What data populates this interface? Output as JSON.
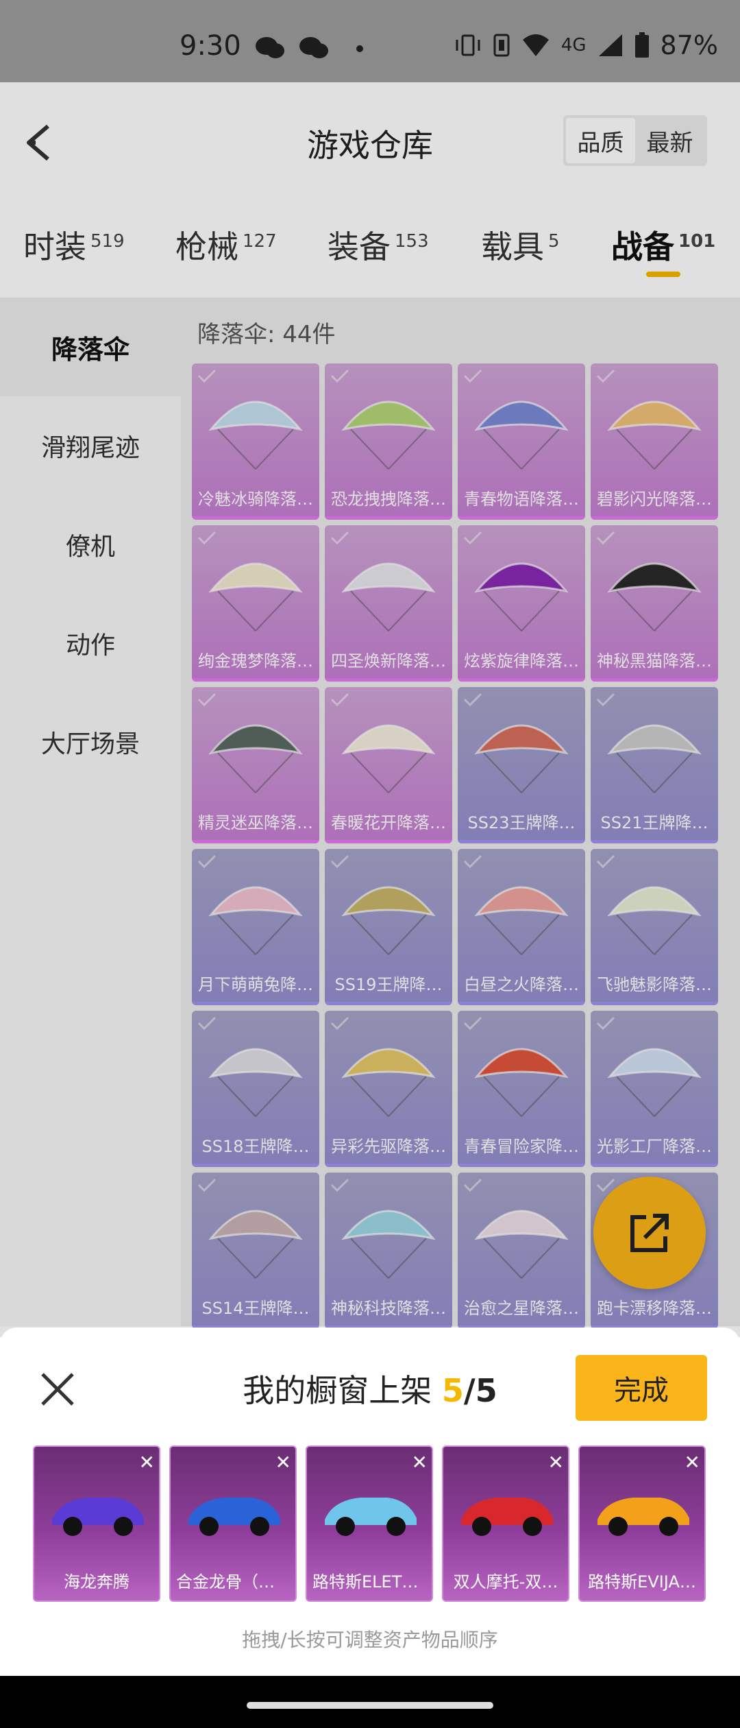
{
  "status_bar": {
    "time": "9:30",
    "network": "4G",
    "battery": "87%"
  },
  "header": {
    "title": "游戏仓库",
    "sort_options": [
      "品质",
      "最新"
    ],
    "sort_active": 0
  },
  "tabs": [
    {
      "label": "时装",
      "count": "519"
    },
    {
      "label": "枪械",
      "count": "127"
    },
    {
      "label": "装备",
      "count": "153"
    },
    {
      "label": "载具",
      "count": "5"
    },
    {
      "label": "战备",
      "count": "101"
    }
  ],
  "active_tab": 4,
  "sidebar": {
    "items": [
      "降落伞",
      "滑翔尾迹",
      "僚机",
      "动作",
      "大厅场景"
    ],
    "active": 0
  },
  "grid": {
    "count_label": "降落伞: 44件",
    "items": [
      {
        "name": "冷魅冰骑降落…",
        "rarity": "pink",
        "color": "#c7e2f2"
      },
      {
        "name": "恐龙拽拽降落…",
        "rarity": "pink",
        "color": "#b6d67a"
      },
      {
        "name": "青春物语降落…",
        "rarity": "pink",
        "color": "#7c8ad6"
      },
      {
        "name": "碧影闪光降落…",
        "rarity": "pink",
        "color": "#f2c27a"
      },
      {
        "name": "绚金瑰梦降落…",
        "rarity": "pink",
        "color": "#f4ead0"
      },
      {
        "name": "四圣焕新降落…",
        "rarity": "pink",
        "color": "#e8e8ee"
      },
      {
        "name": "炫紫旋律降落…",
        "rarity": "pink",
        "color": "#8a2ab6"
      },
      {
        "name": "神秘黑猫降落…",
        "rarity": "pink",
        "color": "#2a2a2a"
      },
      {
        "name": "精灵迷巫降落…",
        "rarity": "pink",
        "color": "#5b6a62"
      },
      {
        "name": "春暖花开降落…",
        "rarity": "pink",
        "color": "#f4eedd"
      },
      {
        "name": "SS23王牌降…",
        "rarity": "purple",
        "color": "#d86f5e"
      },
      {
        "name": "SS21王牌降…",
        "rarity": "purple",
        "color": "#cfcfcf"
      },
      {
        "name": "月下萌萌兔降…",
        "rarity": "purple",
        "color": "#f3c3d3"
      },
      {
        "name": "SS19王牌降…",
        "rarity": "purple",
        "color": "#c9b56a"
      },
      {
        "name": "白昼之火降落…",
        "rarity": "purple",
        "color": "#f0a6a0"
      },
      {
        "name": "飞驰魅影降落…",
        "rarity": "purple",
        "color": "#e6f0d6"
      },
      {
        "name": "SS18王牌降…",
        "rarity": "purple",
        "color": "#e0e0e6"
      },
      {
        "name": "异彩先驱降落…",
        "rarity": "purple",
        "color": "#e6c86a"
      },
      {
        "name": "青春冒险家降…",
        "rarity": "purple",
        "color": "#e2563e"
      },
      {
        "name": "光影工厂降落…",
        "rarity": "purple",
        "color": "#d2e2f6"
      },
      {
        "name": "SS14王牌降…",
        "rarity": "purple",
        "color": "#cbb3b8"
      },
      {
        "name": "神秘科技降落…",
        "rarity": "purple",
        "color": "#9fd8e8"
      },
      {
        "name": "治愈之星降落…",
        "rarity": "purple",
        "color": "#f0e0ea"
      },
      {
        "name": "跑卡漂移降落…",
        "rarity": "purple",
        "color": "#c9c4e8"
      }
    ]
  },
  "showcase": {
    "title_prefix": "我的橱窗上架",
    "current": "5",
    "separator": "/",
    "total": "5",
    "done_label": "完成",
    "hint": "拖拽/长按可调整资产物品顺序",
    "items": [
      {
        "name": "海龙奔腾",
        "color": "#5a3bd6"
      },
      {
        "name": "合金龙骨（蓝…",
        "color": "#2a63d8"
      },
      {
        "name": "路特斯ELETR…",
        "color": "#6fc6ea"
      },
      {
        "name": "双人摩托-双…",
        "color": "#d8282e"
      },
      {
        "name": "路特斯EVIJA…",
        "color": "#f3a11b"
      }
    ]
  },
  "icons": {
    "back": "chevron-left-icon",
    "fab": "share-external-icon",
    "close": "close-icon"
  },
  "colors": {
    "accent": "#fbb419",
    "pink_rarity": "#e679f2",
    "purple_rarity": "#a195ef"
  }
}
